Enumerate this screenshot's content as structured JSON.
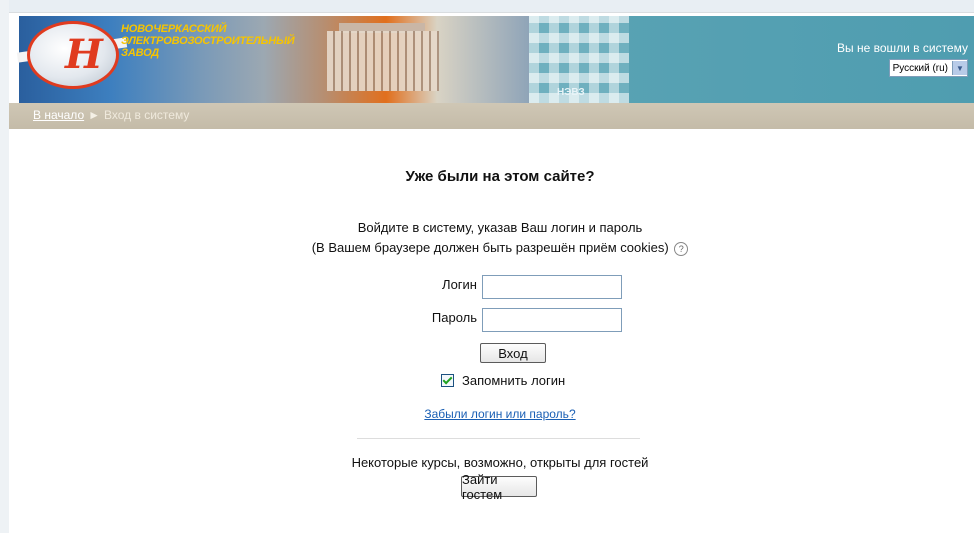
{
  "header": {
    "logo_text": "НОВОЧЕРКАССКИЙ ЭЛЕКТРОВОЗОСТРОИТЕЛЬНЫЙ ЗАВОД",
    "banner_label": "НЭВЗ",
    "login_info": "Вы не вошли в систему",
    "language": {
      "selected": "Русский (ru)"
    }
  },
  "breadcrumb": {
    "home": "В начало",
    "separator": "►",
    "current": "Вход в систему"
  },
  "login": {
    "heading": "Уже были на этом сайте?",
    "instruction_line1": "Войдите в систему, указав Ваш логин и пароль",
    "instruction_line2": "(В Вашем браузере должен быть разрешён приём cookies)",
    "username_label": "Логин",
    "username_value": "",
    "password_label": "Пароль",
    "password_value": "",
    "submit_label": "Вход",
    "remember_label": "Запомнить логин",
    "remember_checked": true,
    "forgot_link": "Забыли логин или пароль?"
  },
  "guest": {
    "text": "Некоторые курсы, возможно, открыты для гостей",
    "button_label": "Зайти гостем"
  }
}
